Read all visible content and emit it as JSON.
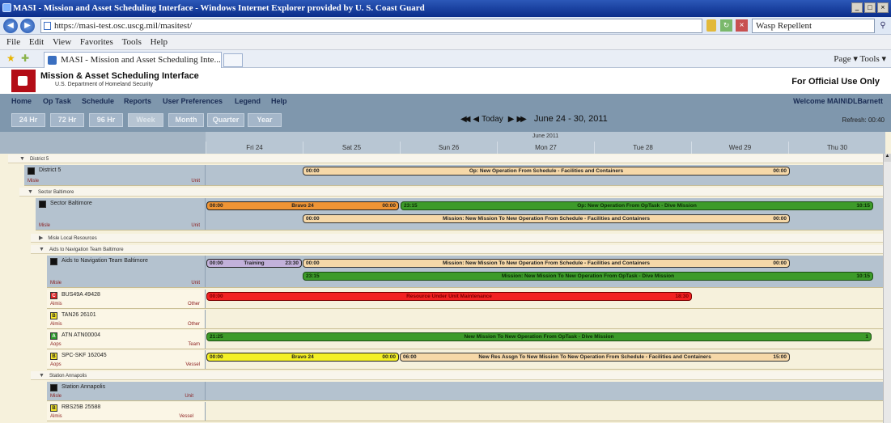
{
  "browser": {
    "title": "MASI - Mission and Asset Scheduling Interface - Windows Internet Explorer provided by U. S. Coast Guard",
    "url": "https://masi-test.osc.uscg.mil/masitest/",
    "search": "Wasp Repellent",
    "menu": [
      "File",
      "Edit",
      "View",
      "Favorites",
      "Tools",
      "Help"
    ],
    "tab_title": "MASI - Mission and Asset Scheduling Inte...",
    "commands": "Page ▾   Tools ▾"
  },
  "app": {
    "title": "Mission & Asset Scheduling Interface",
    "subtitle": "U.S. Department of Homeland Security",
    "fouo": "For Official Use Only",
    "nav": [
      "Home",
      "Op Task",
      "Schedule",
      "Reports",
      "User Preferences",
      "Legend",
      "Help"
    ],
    "welcome": "Welcome MAIN\\DLBarnett",
    "ranges": [
      "24 Hr",
      "72 Hr",
      "96 Hr",
      "Week",
      "Month",
      "Quarter",
      "Year"
    ],
    "today": "Today",
    "date_range": "June 24 - 30, 2011",
    "refresh": "Refresh: 00:40"
  },
  "schedule": {
    "month": "June 2011",
    "days": [
      "Fri 24",
      "Sat 25",
      "Sun 26",
      "Mon 27",
      "Tue 28",
      "Wed 29",
      "Thu 30"
    ],
    "groups": {
      "district": "District 5",
      "sector": "Sector Baltimore",
      "local": "Misle Local Resources",
      "aton": "Aids to Navigation Team Baltimore",
      "station": "Station Annapolis"
    },
    "rows": {
      "d5": {
        "name": "District 5",
        "sub1": "Misle",
        "sub2": "Unit"
      },
      "sb": {
        "name": "Sector Baltimore",
        "sub1": "Misle",
        "sub2": "Unit"
      },
      "at": {
        "name": "Aids to Navigation Team Baltimore",
        "sub1": "Misle",
        "sub2": "Unit"
      },
      "bus": {
        "badge": "C",
        "name": "BUS49A 49428",
        "sub1": "Almis",
        "sub2": "Other"
      },
      "tan": {
        "badge": "B",
        "name": "TAN26 26101",
        "sub1": "Almis",
        "sub2": "Other"
      },
      "atn": {
        "badge": "A",
        "name": "ATN ATN00004",
        "sub1": "Aops",
        "sub2": "Team"
      },
      "spc": {
        "badge": "B",
        "name": "SPC-SKF 162045",
        "sub1": "Aops",
        "sub2": "Vessel"
      },
      "sa": {
        "name": "Station Annapolis",
        "sub1": "Misle",
        "sub2": "Unit"
      },
      "rbs": {
        "badge": "B",
        "name": "RBS25B 25588",
        "sub1": "Almis",
        "sub2": "Vessel"
      }
    },
    "bars": {
      "d5_op": {
        "l": "00:00",
        "c": "Op: New Operation From Schedule - Facilities and Containers",
        "r": "00:00"
      },
      "sb_bravo": {
        "l": "00:00",
        "c": "Bravo 24",
        "r": "00:00"
      },
      "sb_dive": {
        "l": "23:15",
        "c": "Op: New Operation From OpTask - Dive Mission",
        "r": "10:15"
      },
      "sb_mis": {
        "l": "00:00",
        "c": "Mission: New Mission To New Operation From Schedule - Facilities and Containers",
        "r": "00:00"
      },
      "at_train": {
        "l": "00:00",
        "c": "Training",
        "r": "23:30"
      },
      "at_mis": {
        "l": "00:00",
        "c": "Mission: New Mission To New Operation From Schedule - Facilities and Containers",
        "r": "00:00"
      },
      "at_dive": {
        "l": "23:15",
        "c": "Mission: New Mission To New Operation From OpTask - Dive Mission",
        "r": "10:15"
      },
      "bus_maint": {
        "l": "00:00",
        "c": "Resource Under Unit Maintenance",
        "r": "18:30"
      },
      "atn_dive": {
        "l": "21:25",
        "c": "New Mission To New Operation From OpTask - Dive Mission",
        "r": "1"
      },
      "spc_bravo": {
        "l": "00:00",
        "c": "Bravo 24",
        "r": "00:00"
      },
      "spc_res": {
        "l": "06:00",
        "c": "New Res Assgn To New Mission To New Operation From Schedule - Facilities and Containers",
        "r": "15:00"
      }
    }
  },
  "colors": {
    "nav_bg": "#7f97ad",
    "unit_row": "#b4c2cf",
    "canvas": "#f6f1dc",
    "maint": "#f22222",
    "dive": "#3d9b2a"
  }
}
